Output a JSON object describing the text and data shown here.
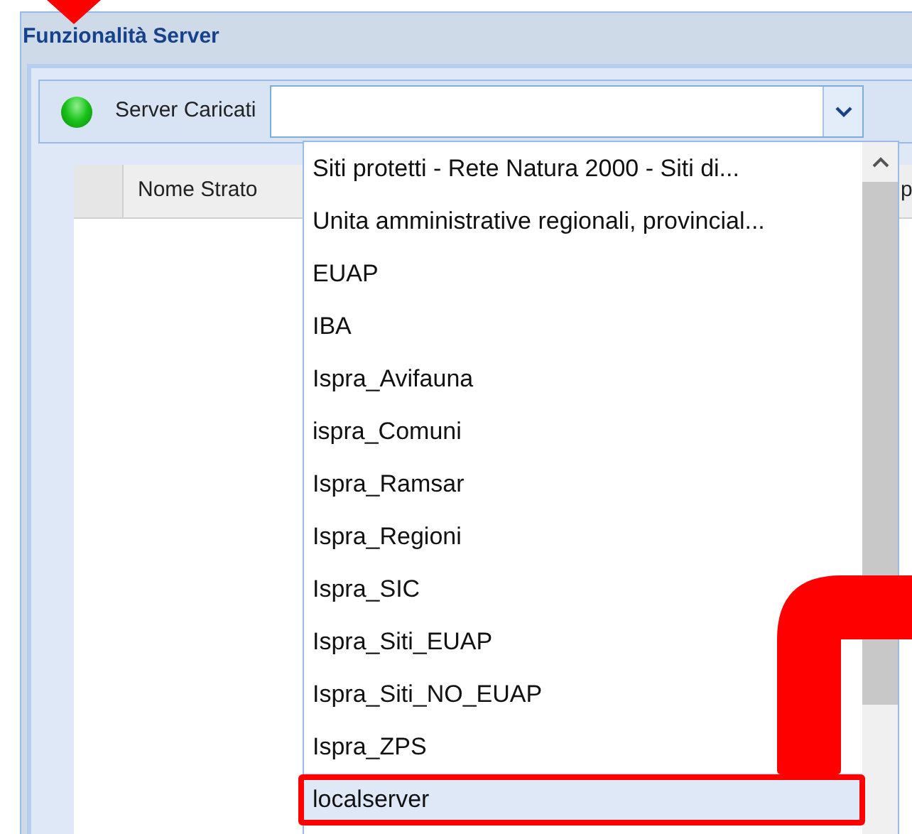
{
  "panel": {
    "title": "Funzionalità Server"
  },
  "toolbar": {
    "online": true,
    "label": "Server Caricati"
  },
  "grid": {
    "columns": [
      "Nome Strato",
      "p"
    ]
  },
  "dropdown": {
    "items": [
      {
        "label": "Siti protetti - Rete Natura 2000 - Siti di...",
        "selected": false
      },
      {
        "label": "Unita amministrative regionali, provincial...",
        "selected": false
      },
      {
        "label": "EUAP",
        "selected": false
      },
      {
        "label": "IBA",
        "selected": false
      },
      {
        "label": "Ispra_Avifauna",
        "selected": false
      },
      {
        "label": "ispra_Comuni",
        "selected": false
      },
      {
        "label": "Ispra_Ramsar",
        "selected": false
      },
      {
        "label": "Ispra_Regioni",
        "selected": false
      },
      {
        "label": "Ispra_SIC",
        "selected": false
      },
      {
        "label": "Ispra_Siti_EUAP",
        "selected": false
      },
      {
        "label": "Ispra_Siti_NO_EUAP",
        "selected": false
      },
      {
        "label": "Ispra_ZPS",
        "selected": false
      },
      {
        "label": "localserver",
        "selected": true
      }
    ]
  }
}
